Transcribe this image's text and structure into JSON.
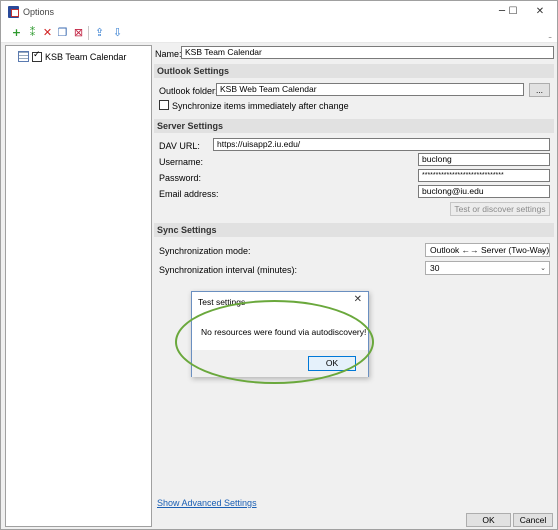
{
  "window": {
    "title": "Options",
    "controls": {
      "minimize": "─",
      "maximize": "☐",
      "close": "✕"
    }
  },
  "toolbar": {
    "icons": [
      "add-icon",
      "add-multiple-icon",
      "delete-icon",
      "copy-icon",
      "delete-multiple-icon",
      "export-icon",
      "import-icon"
    ],
    "grip": "⁼"
  },
  "tree": {
    "items": [
      {
        "label": "KSB Team Calendar",
        "checked": true
      }
    ]
  },
  "profile": {
    "name_label": "Name:",
    "name_value": "KSB Team Calendar"
  },
  "outlook_settings": {
    "heading": "Outlook Settings",
    "folder_label": "Outlook folder:",
    "folder_value": "KSB Web Team Calendar",
    "browse_label": "...",
    "sync_immediately_label": "Synchronize items immediately after change",
    "sync_immediately_checked": false
  },
  "server_settings": {
    "heading": "Server Settings",
    "dav_label": "DAV URL:",
    "dav_value": "https://uisapp2.iu.edu/",
    "username_label": "Username:",
    "username_value": "buclong",
    "password_label": "Password:",
    "password_value": "******************************",
    "email_label": "Email address:",
    "email_value": "buclong@iu.edu",
    "test_button": "Test or discover settings"
  },
  "sync_settings": {
    "heading": "Sync Settings",
    "mode_label": "Synchronization mode:",
    "mode_value": "Outlook ←→ Server (Two-Way)",
    "interval_label": "Synchronization interval (minutes):",
    "interval_value": "30"
  },
  "advanced_link": "Show Advanced Settings",
  "footer": {
    "ok": "OK",
    "cancel": "Cancel"
  },
  "dialog": {
    "title": "Test settings",
    "close": "✕",
    "message": "No resources were found via autodiscovery!",
    "ok": "OK"
  },
  "colors": {
    "annotation": "#6aa83c",
    "link": "#1a5fb4",
    "accent": "#0078d7"
  }
}
